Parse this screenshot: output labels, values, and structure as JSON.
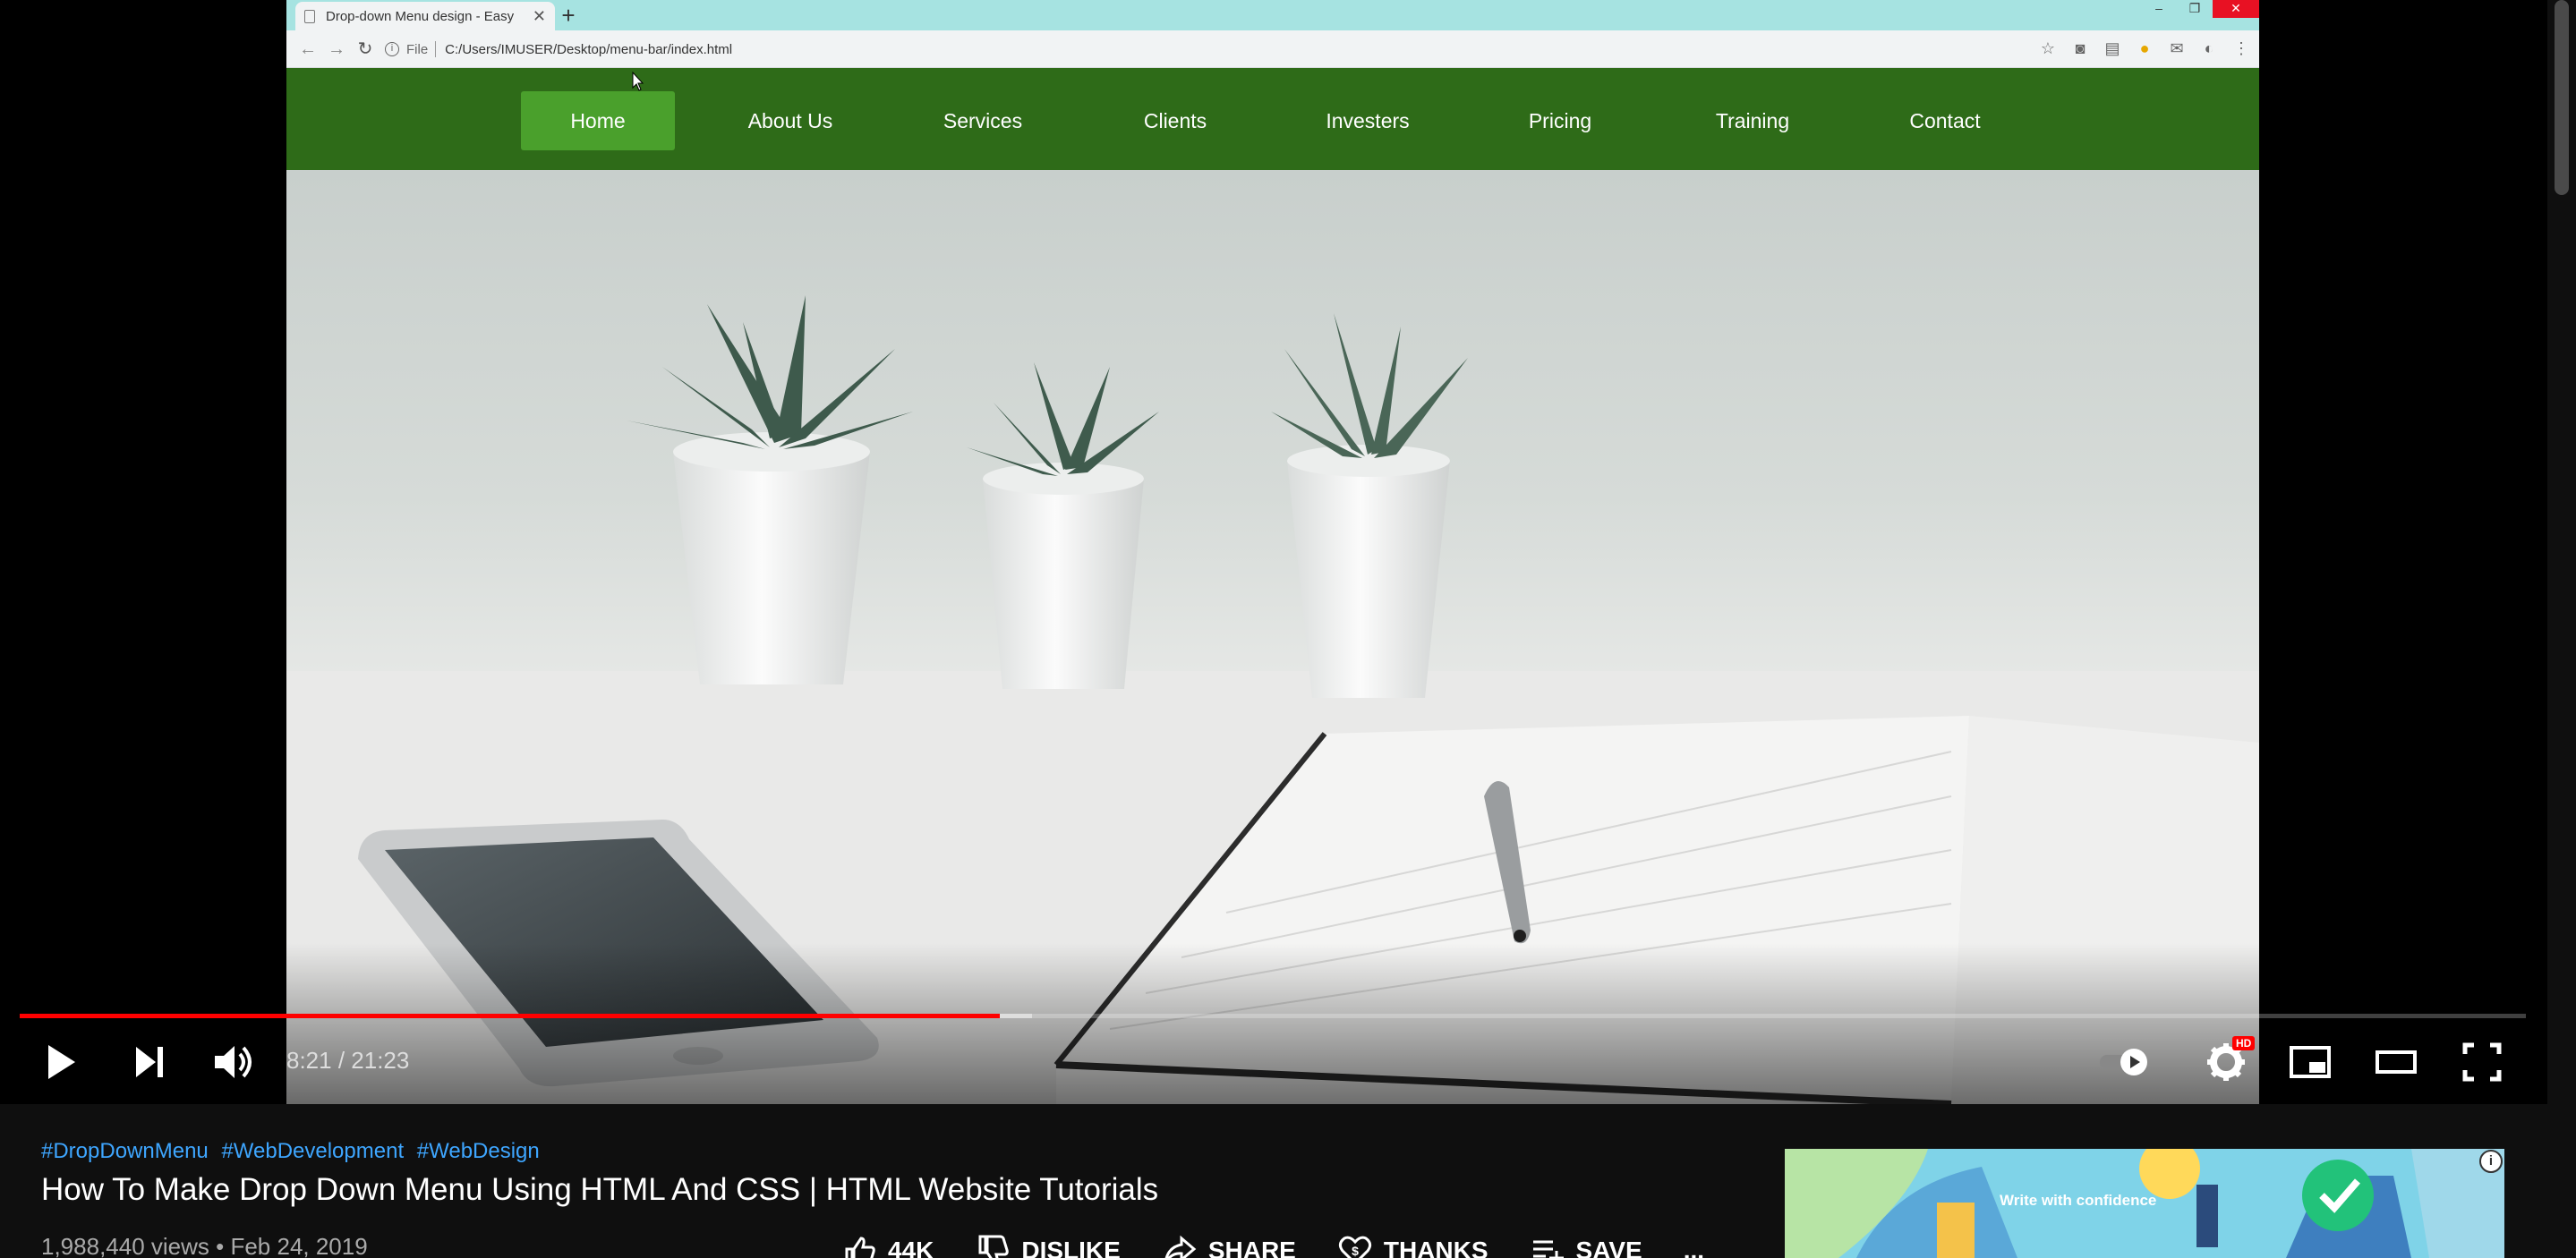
{
  "browser": {
    "tab_title": "Drop-down Menu design - Easy",
    "tab_close": "✕",
    "new_tab": "+",
    "file_label": "File",
    "url": "C:/Users/IMUSER/Desktop/menu-bar/index.html"
  },
  "site_nav": {
    "items": [
      {
        "label": "Home",
        "active": true
      },
      {
        "label": "About Us"
      },
      {
        "label": "Services"
      },
      {
        "label": "Clients"
      },
      {
        "label": "Investers"
      },
      {
        "label": "Pricing"
      },
      {
        "label": "Training"
      },
      {
        "label": "Contact"
      }
    ]
  },
  "player": {
    "current_time": "8:21",
    "duration": "21:23",
    "time_display": "8:21 / 21:23",
    "played_fraction": 0.391,
    "buffered_fraction": 0.404,
    "quality_badge": "HD"
  },
  "video": {
    "hashtags": [
      "#DropDownMenu",
      "#WebDevelopment",
      "#WebDesign"
    ],
    "title": "How To Make Drop Down Menu Using HTML And CSS | HTML Website Tutorials",
    "meta": "1,988,440 views • Feb 24, 2019",
    "actions": {
      "like": "44K",
      "dislike": "DISLIKE",
      "share": "SHARE",
      "thanks": "THANKS",
      "save": "SAVE",
      "more": "..."
    }
  },
  "ad": {
    "text": "Write with confidence",
    "info": "i"
  },
  "colors": {
    "nav_bg": "#2e6b18",
    "nav_active": "#4aa02c",
    "progress_played": "#ff0000",
    "hashtag": "#3ea6ff"
  }
}
